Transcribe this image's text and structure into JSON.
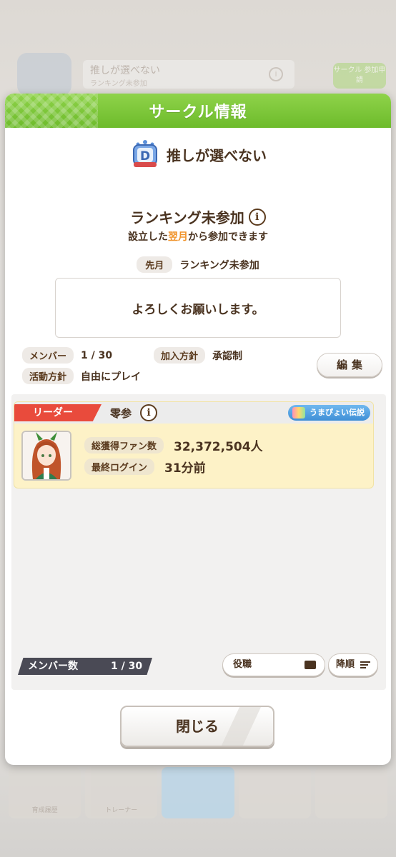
{
  "background": {
    "circle_name": "推しが選べない",
    "circle_sub": "ランキング未参加",
    "green_button_label": "サークル 参加申請",
    "menu": [
      {
        "label": "育成履歴"
      },
      {
        "label": "トレーナー"
      },
      {
        "label": ""
      },
      {
        "label": ""
      },
      {
        "label": ""
      }
    ]
  },
  "modal": {
    "title": "サークル情報",
    "circle_name": "推しが選べない",
    "rank_badge_letter": "D",
    "ranking_status": "ランキング未参加",
    "ranking_note_before": "設立した",
    "ranking_note_accent": "翌月",
    "ranking_note_after": "から参加できます",
    "last_month_label": "先月",
    "last_month_value": "ランキング未参加",
    "comment": "よろしくお願いします。",
    "members_label": "メンバー",
    "members_value": "1 / 30",
    "join_policy_label": "加入方針",
    "join_policy_value": "承認制",
    "activity_policy_label": "活動方針",
    "activity_policy_value": "自由にプレイ",
    "edit_button": "編集",
    "info_icon_glyph": "i",
    "member_list": {
      "leader_label": "リーダー",
      "member_name": "零参",
      "title_badge": "うまぴょい伝説",
      "fans_label": "総獲得ファン数",
      "fans_value": "32,372,504人",
      "last_login_label": "最終ログイン",
      "last_login_value": "31分前"
    },
    "member_count_label": "メンバー数",
    "member_count_value": "1 / 30",
    "role_button": "役職",
    "sort_button": "降順",
    "close_button": "閉じる"
  },
  "colors": {
    "header_green": "#7cc63a",
    "accent_orange": "#f0932b",
    "leader_red": "#e94b3c",
    "member_card_bg": "#fdf2c7",
    "text_brown": "#4a3320"
  }
}
